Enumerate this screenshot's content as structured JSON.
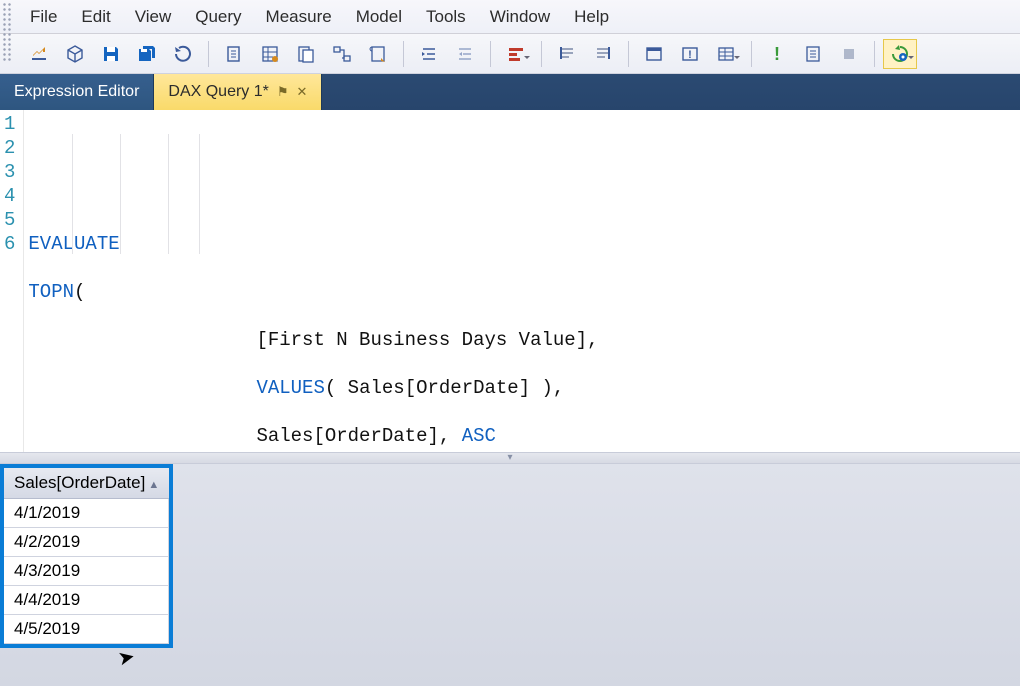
{
  "menu": {
    "items": [
      "File",
      "Edit",
      "View",
      "Query",
      "Measure",
      "Model",
      "Tools",
      "Window",
      "Help"
    ]
  },
  "toolbar": {
    "buttons": [
      {
        "name": "new-query-icon"
      },
      {
        "name": "cube-icon"
      },
      {
        "name": "save-icon"
      },
      {
        "name": "save-all-icon"
      },
      {
        "name": "undo-icon"
      }
    ],
    "group2": [
      {
        "name": "copy-icon"
      },
      {
        "name": "grid-icon"
      },
      {
        "name": "page-icon"
      },
      {
        "name": "dependency-icon"
      },
      {
        "name": "script-icon"
      }
    ],
    "group3": [
      {
        "name": "indent-icon"
      },
      {
        "name": "outdent-icon"
      }
    ],
    "group4": [
      {
        "name": "format-dax-icon"
      }
    ],
    "group5": [
      {
        "name": "align-top-icon"
      },
      {
        "name": "align-bottom-icon"
      }
    ],
    "group6": [
      {
        "name": "window1-icon"
      },
      {
        "name": "warning-icon"
      },
      {
        "name": "properties-icon"
      }
    ],
    "group7": [
      {
        "name": "info-green-icon"
      },
      {
        "name": "list-icon"
      },
      {
        "name": "stop-icon"
      }
    ],
    "run": {
      "name": "run-query-icon"
    }
  },
  "tabs": {
    "items": [
      {
        "label": "Expression Editor",
        "active": false
      },
      {
        "label": "DAX Query 1*",
        "active": true
      }
    ]
  },
  "code": {
    "lines": [
      {
        "n": 1,
        "tokens": [
          {
            "t": "EVALUATE",
            "c": "kw"
          }
        ]
      },
      {
        "n": 2,
        "tokens": [
          {
            "t": "TOPN",
            "c": "kw"
          },
          {
            "t": "(",
            "c": "plain"
          }
        ]
      },
      {
        "n": 3,
        "tokens": [
          {
            "t": "                    [First N Business Days Value],",
            "c": "plain"
          }
        ]
      },
      {
        "n": 4,
        "tokens": [
          {
            "t": "                    ",
            "c": "plain"
          },
          {
            "t": "VALUES",
            "c": "kw"
          },
          {
            "t": "( Sales[OrderDate] ),",
            "c": "plain"
          }
        ]
      },
      {
        "n": 5,
        "tokens": [
          {
            "t": "                    Sales[OrderDate], ",
            "c": "plain"
          },
          {
            "t": "ASC",
            "c": "kw"
          }
        ]
      },
      {
        "n": 6,
        "tokens": [
          {
            "t": "                )",
            "c": "plain"
          }
        ]
      }
    ]
  },
  "results": {
    "column": "Sales[OrderDate]",
    "rows": [
      "4/1/2019",
      "4/2/2019",
      "4/3/2019",
      "4/4/2019",
      "4/5/2019"
    ]
  }
}
